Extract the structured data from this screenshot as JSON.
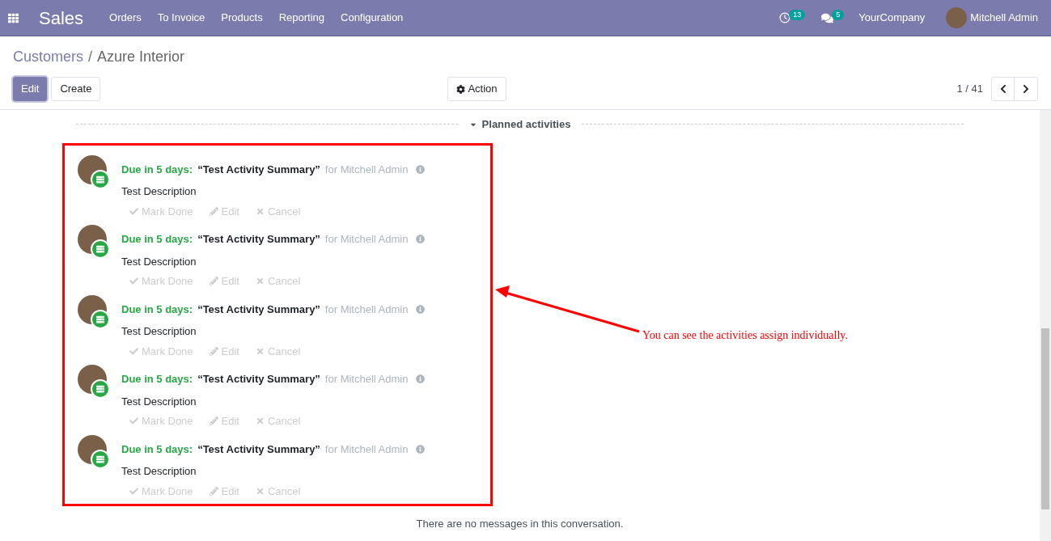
{
  "navbar": {
    "app_name": "Sales",
    "menu": [
      "Orders",
      "To Invoice",
      "Products",
      "Reporting",
      "Configuration"
    ],
    "activity_count": "13",
    "message_count": "5",
    "company": "YourCompany",
    "user": "Mitchell Admin"
  },
  "breadcrumb": [
    {
      "label": "Customers",
      "kind": "link"
    },
    {
      "label": "/",
      "kind": "separator"
    },
    {
      "label": "Azure Interior",
      "kind": "current"
    }
  ],
  "buttons": {
    "edit": "Edit",
    "create": "Create",
    "action": "Action"
  },
  "pager": "1 / 41",
  "section_title": "Planned activities",
  "activities": [
    {
      "due": "Due in 5 days:",
      "summary": "“Test Activity Summary”",
      "assignee": "for Mitchell Admin",
      "description": "Test Description",
      "actions": [
        "Mark Done",
        "Edit",
        "Cancel"
      ]
    },
    {
      "due": "Due in 5 days:",
      "summary": "“Test Activity Summary”",
      "assignee": "for Mitchell Admin",
      "description": "Test Description",
      "actions": [
        "Mark Done",
        "Edit",
        "Cancel"
      ]
    },
    {
      "due": "Due in 5 days:",
      "summary": "“Test Activity Summary”",
      "assignee": "for Mitchell Admin",
      "description": "Test Description",
      "actions": [
        "Mark Done",
        "Edit",
        "Cancel"
      ]
    },
    {
      "due": "Due in 5 days:",
      "summary": "“Test Activity Summary”",
      "assignee": "for Mitchell Admin",
      "description": "Test Description",
      "actions": [
        "Mark Done",
        "Edit",
        "Cancel"
      ]
    },
    {
      "due": "Due in 5 days:",
      "summary": "“Test Activity Summary”",
      "assignee": "for Mitchell Admin",
      "description": "Test Description",
      "actions": [
        "Mark Done",
        "Edit",
        "Cancel"
      ]
    }
  ],
  "annotation": "You can see the activities assign individually.",
  "empty_message": "There are no messages in this conversation."
}
